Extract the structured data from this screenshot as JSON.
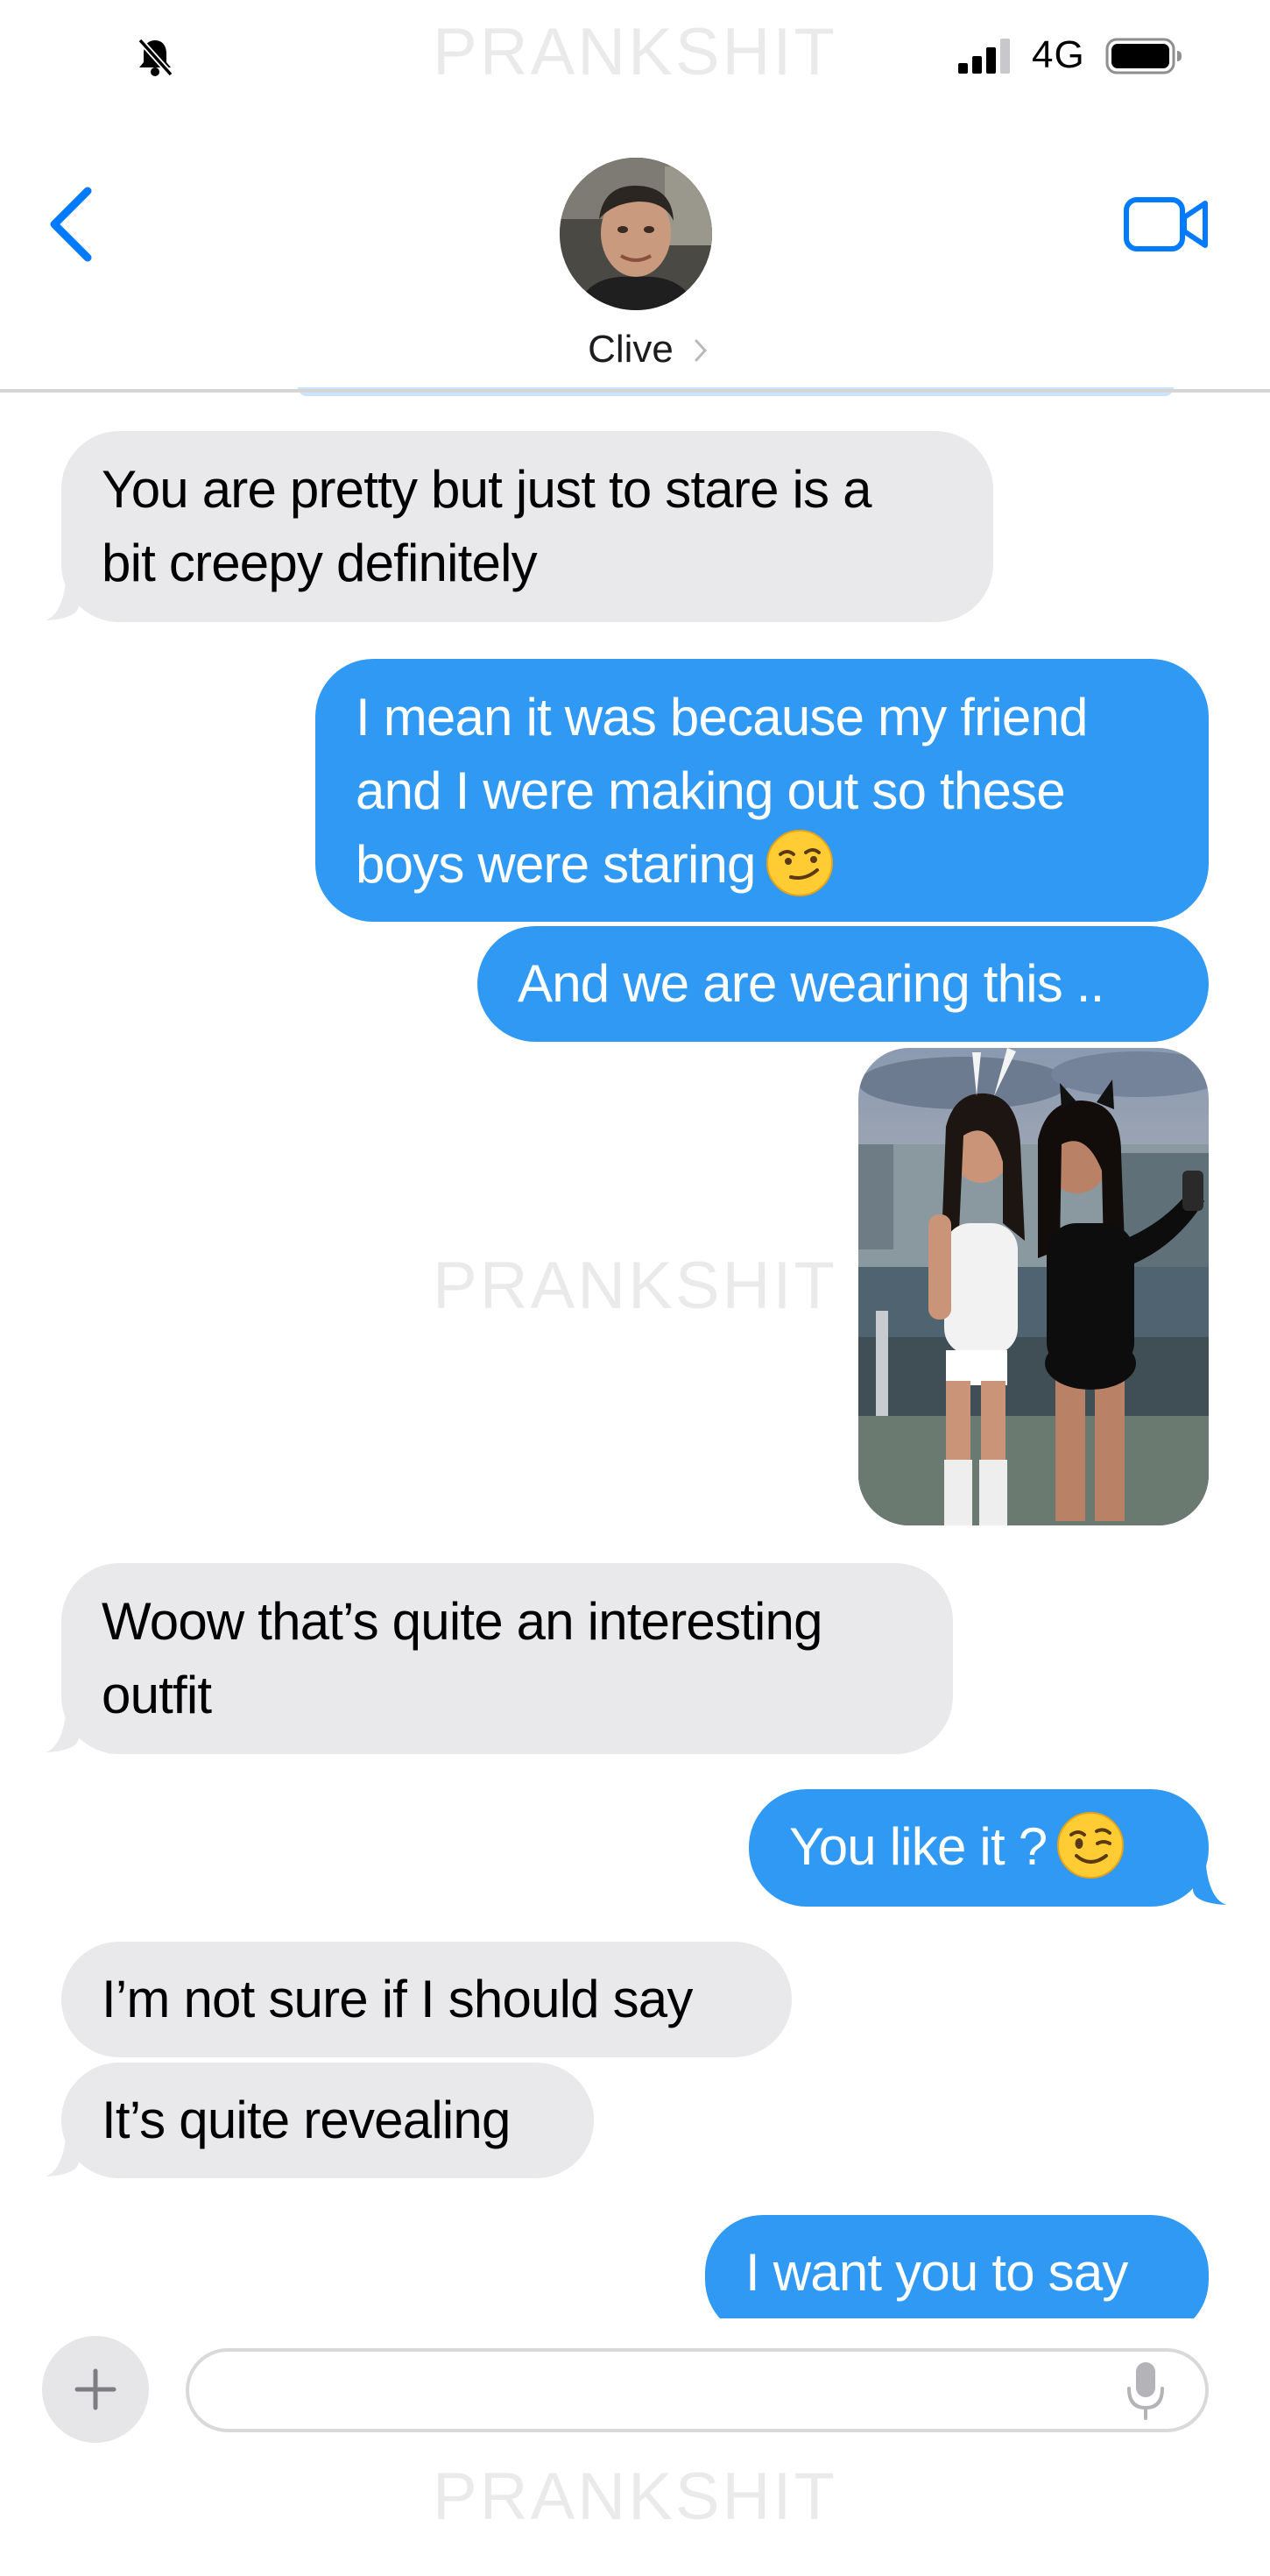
{
  "status_bar": {
    "network": "4G"
  },
  "watermark": "PRANKSHIT",
  "header": {
    "contact_name": "Clive"
  },
  "messages": [
    {
      "direction": "incoming",
      "lines": [
        "You are pretty but just to stare is a",
        "bit creepy definitely"
      ]
    },
    {
      "direction": "outgoing",
      "lines": [
        "I mean it was because my friend",
        "and I were making out  so these",
        "boys were staring"
      ],
      "emoji": "smirking-face"
    },
    {
      "direction": "outgoing",
      "lines": [
        "And we are wearing this .."
      ]
    },
    {
      "direction": "outgoing",
      "type": "photo"
    },
    {
      "direction": "incoming",
      "lines": [
        "Woow that’s quite an interesting",
        "outfit"
      ]
    },
    {
      "direction": "outgoing",
      "lines": [
        "You like it ?"
      ],
      "emoji": "winking-face"
    },
    {
      "direction": "incoming",
      "lines": [
        "I’m not sure if I should say"
      ]
    },
    {
      "direction": "incoming",
      "lines": [
        "It’s quite revealing"
      ]
    },
    {
      "direction": "outgoing",
      "lines": [
        "I want you to say"
      ]
    }
  ],
  "composer": {
    "value": "",
    "placeholder": ""
  },
  "colors": {
    "accent": "#007aff",
    "outgoing_bubble": "#2f99f3",
    "incoming_bubble": "#e9e9eb"
  }
}
